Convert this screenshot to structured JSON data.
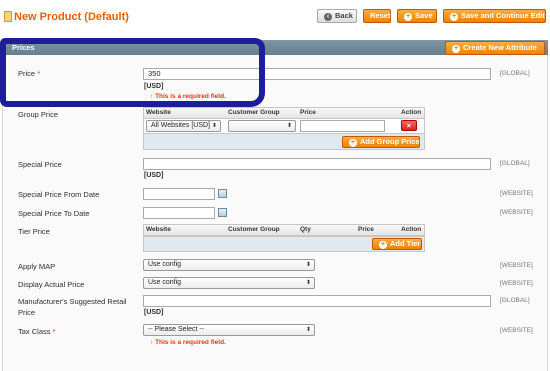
{
  "header": {
    "title": "New Product (Default)",
    "back_label": "Back",
    "reset_label": "Reset",
    "save_label": "Save",
    "save_continue_label": "Save and Continue Edit"
  },
  "section": {
    "title": "Prices",
    "create_attribute_label": "Create New Attribute"
  },
  "fields": {
    "price": {
      "label": "Price",
      "required_mark": "*",
      "value": "350",
      "currency": "[USD]",
      "error": "This is a required field.",
      "scope": "[GLOBAL]"
    },
    "group_price": {
      "label": "Group Price",
      "columns": [
        "Website",
        "Customer Group",
        "Price",
        "Action"
      ],
      "row": {
        "website": "All Websites [USD]",
        "customer_group": "",
        "price": ""
      },
      "add_label": "Add Group Price"
    },
    "special_price": {
      "label": "Special Price",
      "value": "",
      "currency": "[USD]",
      "scope": "[GLOBAL]"
    },
    "special_from": {
      "label": "Special Price From Date",
      "value": "",
      "scope": "[WEBSITE]"
    },
    "special_to": {
      "label": "Special Price To Date",
      "value": "",
      "scope": "[WEBSITE]"
    },
    "tier_price": {
      "label": "Tier Price",
      "columns": [
        "Website",
        "Customer Group",
        "Qty",
        "Price",
        "Action"
      ],
      "add_label": "Add Tier"
    },
    "apply_map": {
      "label": "Apply MAP",
      "value": "Use config",
      "scope": "[WEBSITE]"
    },
    "display_actual_price": {
      "label": "Display Actual Price",
      "value": "Use config",
      "scope": "[WEBSITE]"
    },
    "msrp": {
      "label_line1": "Manufacturer's Suggested Retail",
      "label_line2": "Price",
      "value": "",
      "currency": "[USD]",
      "scope": "[GLOBAL]"
    },
    "tax_class": {
      "label": "Tax Class",
      "required_mark": "*",
      "value": "-- Please Select --",
      "error": "This is a required field.",
      "scope": "[WEBSITE]"
    }
  },
  "icons": {
    "error_arrow": "↑",
    "plus": "+",
    "back_arrow": "‹",
    "delete": "×",
    "select_arrows": "⬍"
  }
}
